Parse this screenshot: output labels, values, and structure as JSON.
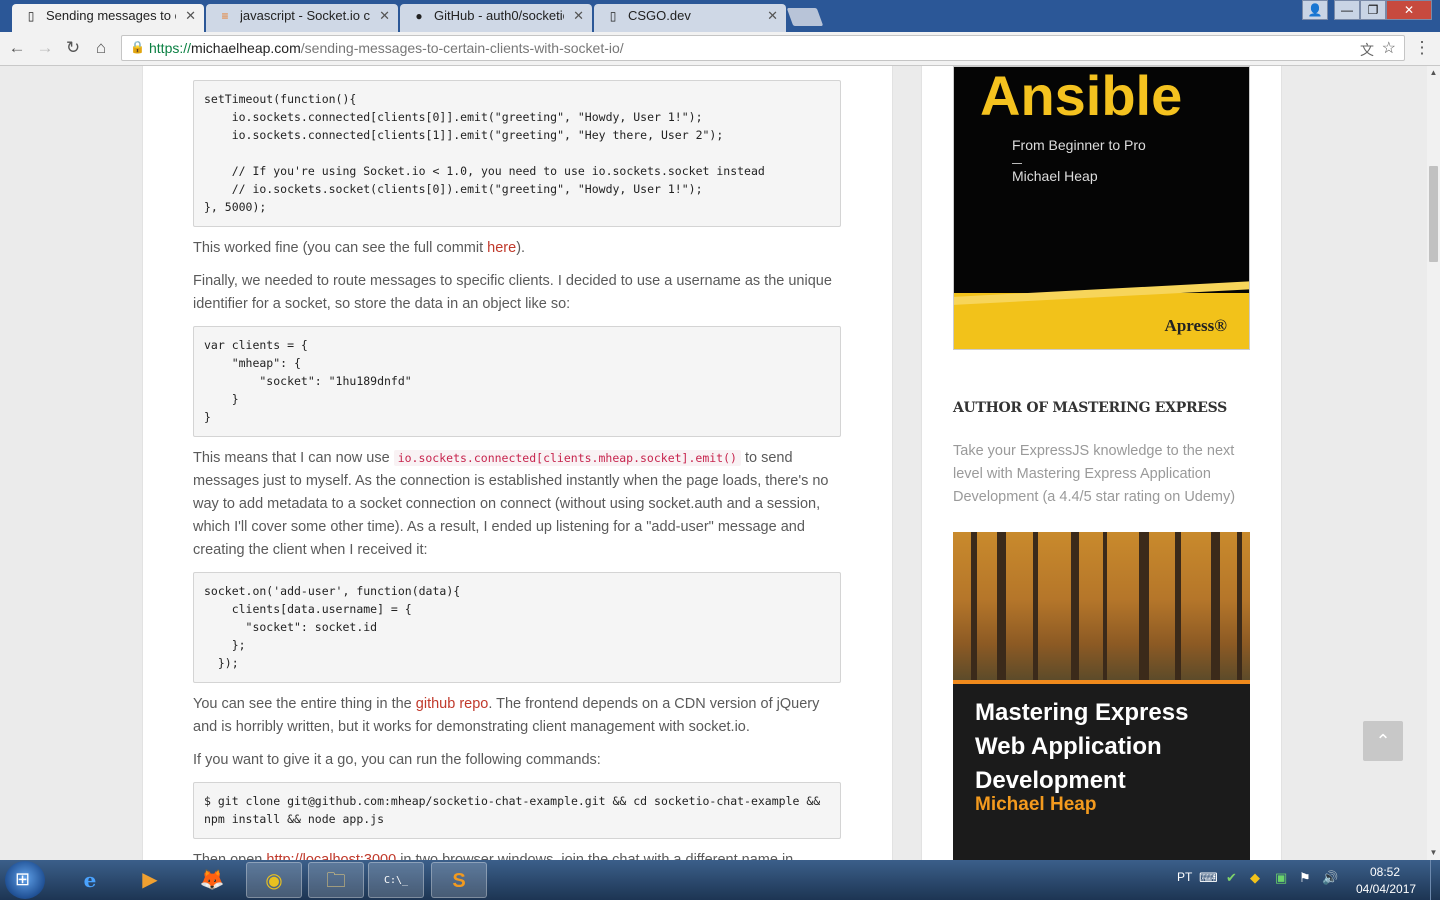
{
  "tabs": [
    {
      "title": "Sending messages to cer",
      "favicon": "page-icon",
      "active": true
    },
    {
      "title": "javascript - Socket.io cus",
      "favicon": "stackoverflow-icon",
      "active": false
    },
    {
      "title": "GitHub - auth0/socketio-",
      "favicon": "github-icon",
      "active": false
    },
    {
      "title": "CSGO.dev",
      "favicon": "page-icon",
      "active": false
    }
  ],
  "window_controls": {
    "user": "👤",
    "minimize": "—",
    "maximize": "❐",
    "close": "✕"
  },
  "toolbar": {
    "back_icon": "←",
    "forward_icon": "→",
    "reload_icon": "↻",
    "home_icon": "⌂",
    "menu_icon": "⋮",
    "url_scheme": "https://",
    "url_host": "michaelheap.com",
    "url_path": "/sending-messages-to-certain-clients-with-socket-io/"
  },
  "article": {
    "code1": "setTimeout(function(){\n    io.sockets.connected[clients[0]].emit(\"greeting\", \"Howdy, User 1!\");\n    io.sockets.connected[clients[1]].emit(\"greeting\", \"Hey there, User 2\");\n\n    // If you're using Socket.io < 1.0, you need to use io.sockets.socket instead\n    // io.sockets.socket(clients[0]).emit(\"greeting\", \"Howdy, User 1!\");\n}, 5000);",
    "p1_before": "This worked fine (you can see the full commit ",
    "p1_link": "here",
    "p1_after": ").",
    "p2": "Finally, we needed to route messages to specific clients. I decided to use a username as the unique identifier for a socket, so store the data in an object like so:",
    "code2": "var clients = {\n    \"mheap\": {\n        \"socket\": \"1hu189dnfd\"\n    }\n}",
    "p3_before": "This means that I can now use ",
    "p3_code": "io.sockets.connected[clients.mheap.socket].emit()",
    "p3_after": " to send messages just to myself. As the connection is established instantly when the page loads, there's no way to add metadata to a socket connection on connect (without using socket.auth and a session, which I'll cover some other time). As a result, I ended up listening for a \"add-user\" message and creating the client when I received it:",
    "code3": "socket.on('add-user', function(data){\n    clients[data.username] = {\n      \"socket\": socket.id\n    };\n  });",
    "p4_before": "You can see the entire thing in the ",
    "p4_link": "github repo",
    "p4_after": ". The frontend depends on a CDN version of jQuery and is horribly written, but it works for demonstrating client management with socket.io.",
    "p5": "If you want to give it a go, you can run the following commands:",
    "code4": "$ git clone git@github.com:mheap/socketio-chat-example.git && cd socketio-chat-example &&\nnpm install && node app.js",
    "p6_before": "Then open ",
    "p6_link": "http://localhost:3000",
    "p6_after": " in two browser windows, join the chat with a different name in"
  },
  "sidebar": {
    "book1": {
      "title": "Ansible",
      "subtitle": "From Beginner to Pro",
      "author": "Michael Heap",
      "publisher": "Apress®"
    },
    "heading": "AUTHOR OF MASTERING EXPRESS",
    "description": "Take your ExpressJS knowledge to the next level with Mastering Express Application Development (a 4.4/5 star rating on Udemy)",
    "book2": {
      "title": "Mastering Express Web Application Development",
      "author": "Michael Heap"
    }
  },
  "back_to_top_icon": "⌃",
  "taskbar": {
    "apps": [
      {
        "name": "internet-explorer",
        "glyph": "e",
        "running": false
      },
      {
        "name": "media-player",
        "glyph": "▶",
        "running": false
      },
      {
        "name": "firefox",
        "glyph": "🦊",
        "running": false
      },
      {
        "name": "chrome",
        "glyph": "◉",
        "running": true
      },
      {
        "name": "file-explorer",
        "glyph": "🗀",
        "running": true
      },
      {
        "name": "command-prompt",
        "glyph": "C:\\_",
        "running": true
      },
      {
        "name": "sublime-text",
        "glyph": "S",
        "running": true
      }
    ],
    "language": "PT",
    "time": "08:52",
    "date": "04/04/2017"
  },
  "colors": {
    "link": "#c0392b",
    "accent_yellow": "#f4c21f",
    "accent_orange": "#f39a1e"
  }
}
